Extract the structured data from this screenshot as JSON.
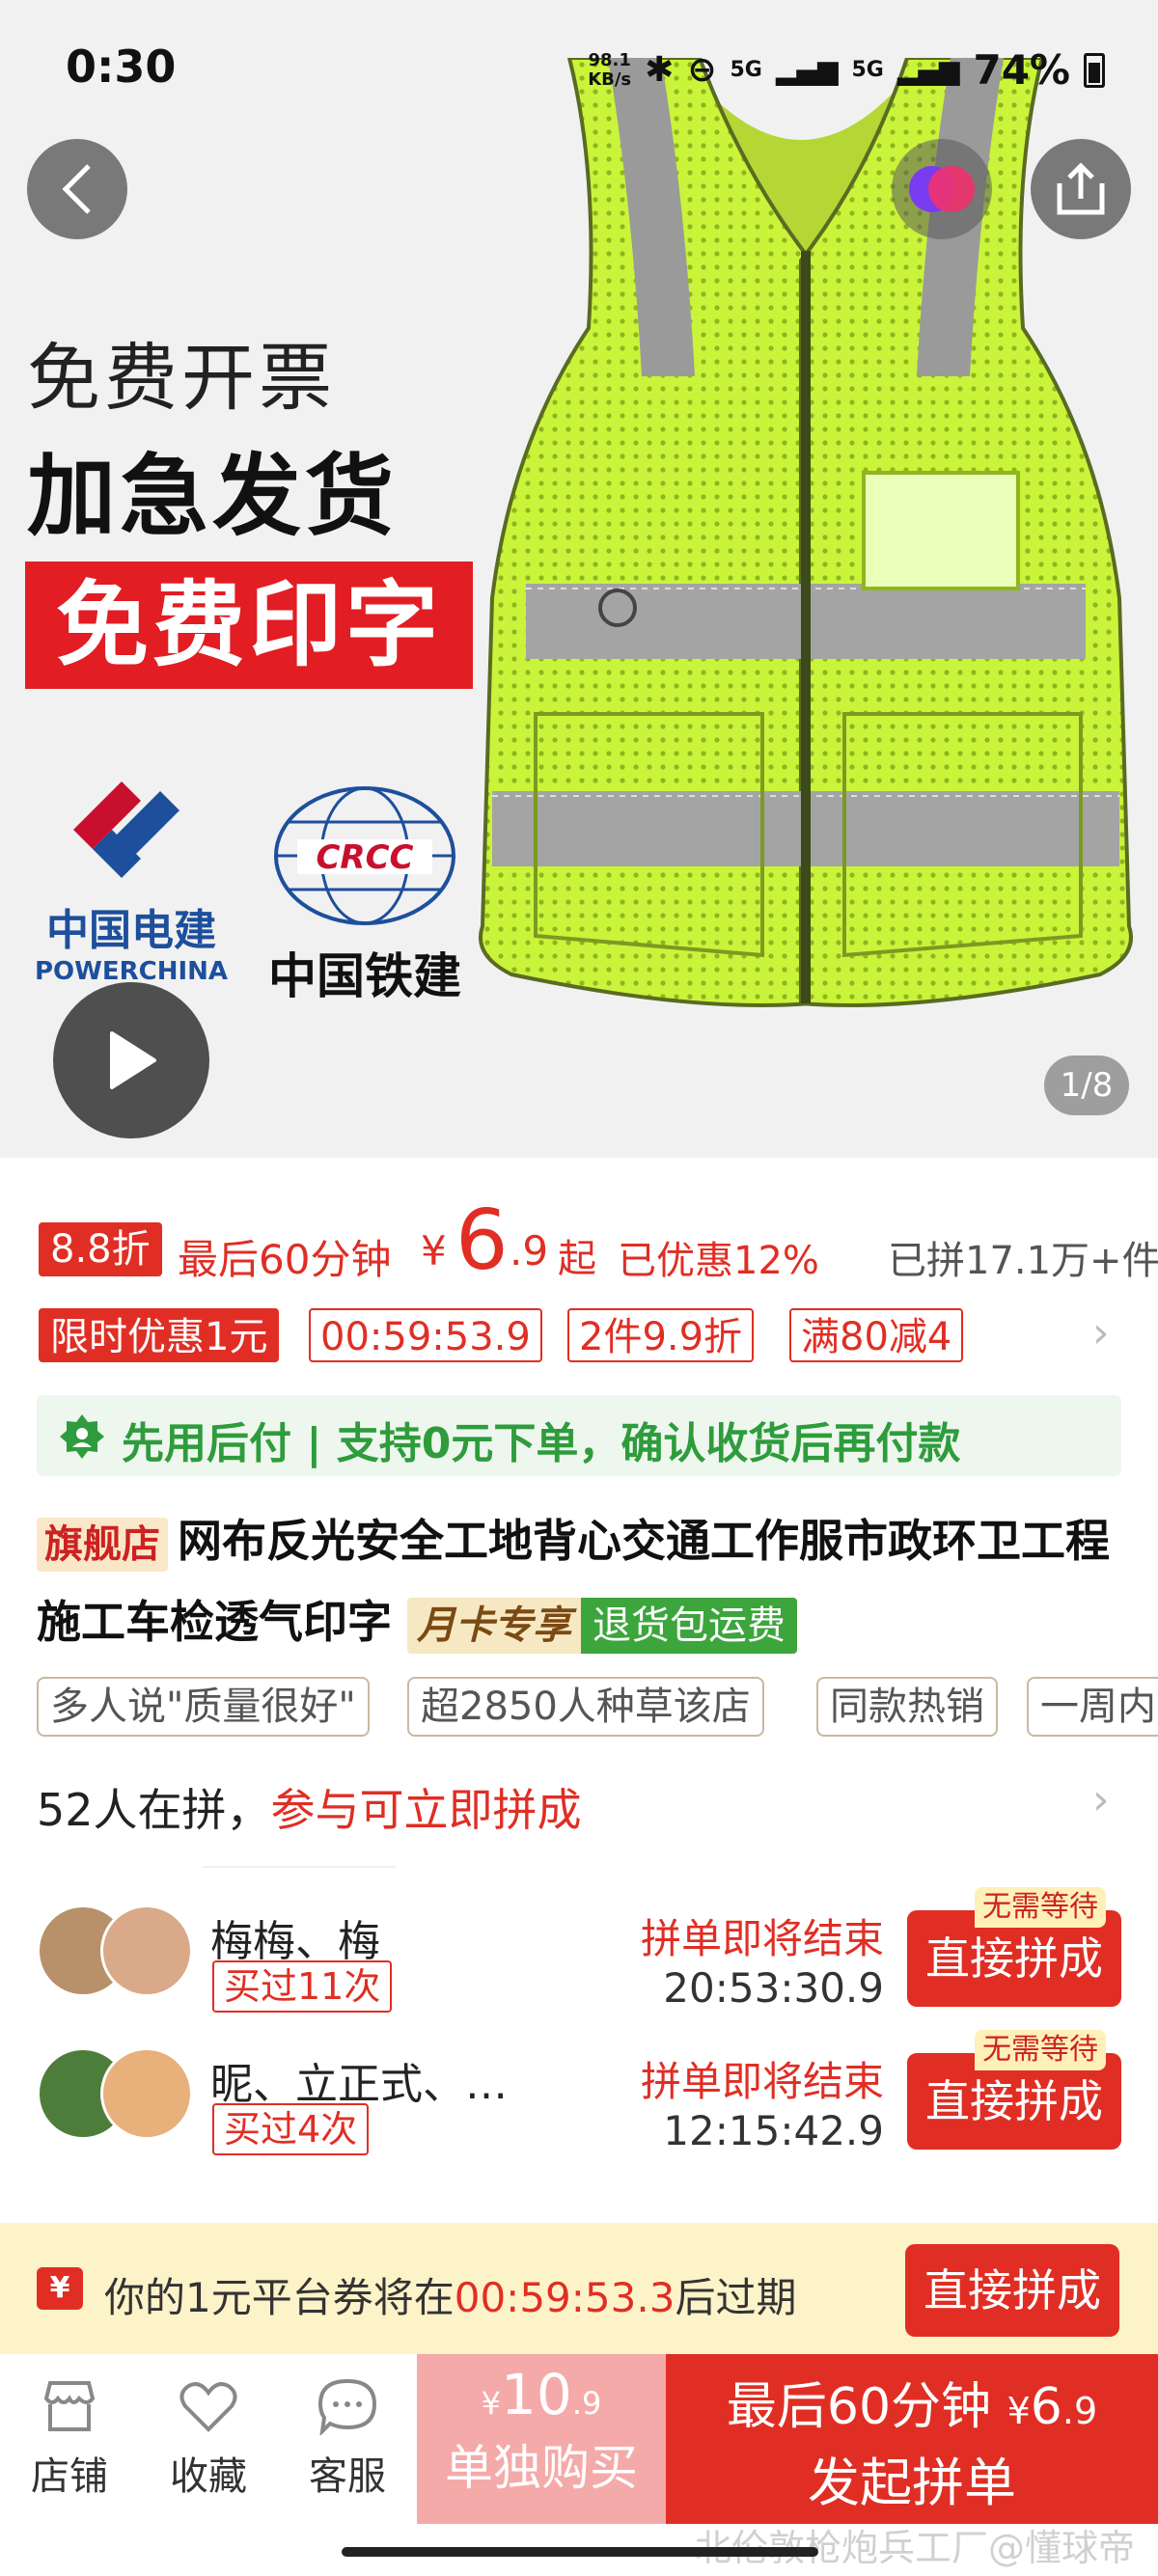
{
  "status_bar": {
    "time": "0:30",
    "net_speed_value": "98.1",
    "net_speed_unit": "KB/s",
    "signal1": "5G",
    "signal2": "5G",
    "battery": "74%"
  },
  "hero": {
    "line1": "免费开票",
    "line2": "加急发货",
    "line3": "免费印字",
    "logo1_cn": "中国电建",
    "logo1_en": "POWERCHINA",
    "logo2_mark": "CRCC",
    "logo2_cn": "中国铁建",
    "image_counter": "1/8"
  },
  "price": {
    "discount_badge": "8.8折",
    "countdown_label": "最后60分钟",
    "currency": "¥",
    "price_int": "6",
    "price_dec": ".9",
    "price_suffix": "起",
    "saved": "已优惠12%",
    "sold": "已拼17.1万+件"
  },
  "promo": {
    "limited": "限时优惠1元",
    "timer": "00:59:53.9",
    "tag1": "2件9.9折",
    "tag2": "满80减4"
  },
  "paylater": {
    "text": "先用后付 | 支持0元下单，确认收货后再付款"
  },
  "product": {
    "store_badge": "旗舰店",
    "title": "网布反光安全工地背心交通工作服市政环卫工程施工车检透气印字",
    "card_badge": "月卡专享",
    "return_badge": "退货包运费"
  },
  "chips": [
    "多人说\"质量很好\"",
    "超2850人种草该店",
    "同款热销",
    "一周内"
  ],
  "group_buy": {
    "count_text": "52人在拼，",
    "join_text": "参与可立即拼成",
    "groups": [
      {
        "names": "梅梅、梅",
        "bought": "买过11次",
        "ending": "拼单即将结束",
        "timer": "20:53:30.9",
        "button": "直接拼成",
        "nowait": "无需等待"
      },
      {
        "names": "昵、立正式、…",
        "bought": "买过4次",
        "ending": "拼单即将结束",
        "timer": "12:15:42.9",
        "button": "直接拼成",
        "nowait": "无需等待"
      }
    ]
  },
  "coupon_bar": {
    "icon": "¥",
    "text_before": "你的1元平台券将在",
    "time": "00:59:53.3",
    "text_after": "后过期",
    "button": "直接拼成"
  },
  "bottom_bar": {
    "store": "店铺",
    "favorite": "收藏",
    "service": "客服",
    "alone_currency": "¥",
    "alone_price_int": "10",
    "alone_price_dec": ".9",
    "alone_label": "单独购买",
    "group_countdown": "最后60分钟",
    "group_currency": "¥",
    "group_price_int": "6",
    "group_price_dec": ".9",
    "group_label": "发起拼单"
  },
  "watermark": "北伦敦枪炮兵工厂@懂球帝",
  "colors": {
    "accent_red": "#e02e24",
    "green": "#2e9c3c",
    "vest_yellow": "#c9f43a"
  }
}
